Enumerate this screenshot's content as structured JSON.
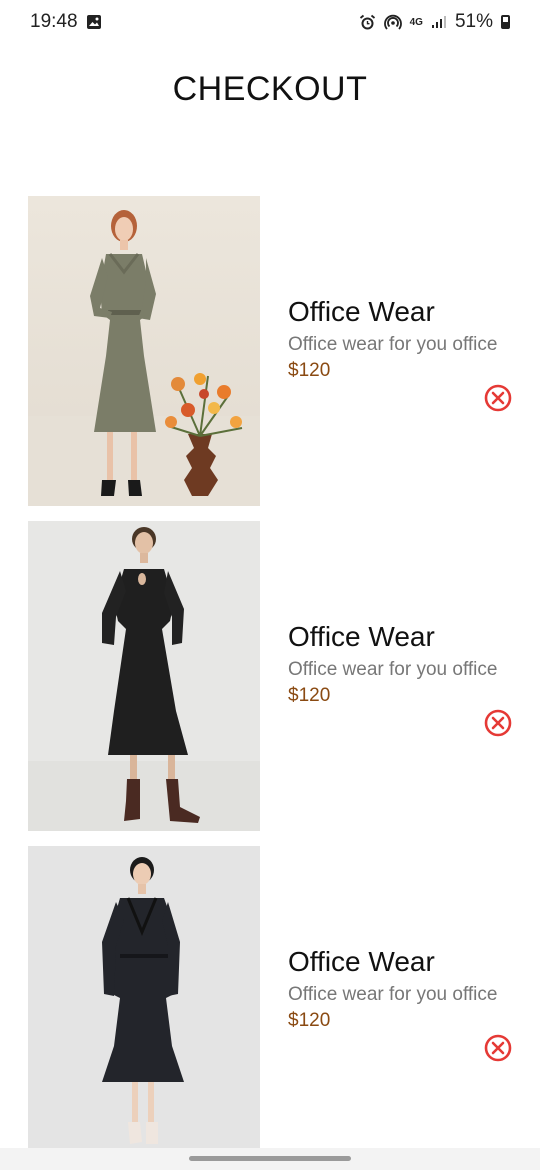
{
  "status_bar": {
    "time": "19:48",
    "network_label": "4G",
    "battery_percent": "51%",
    "icons": [
      "gallery-icon",
      "alarm-icon",
      "hotspot-icon",
      "signal-icon",
      "battery-icon"
    ]
  },
  "page": {
    "title": "CHECKOUT"
  },
  "products": [
    {
      "name": "Office Wear",
      "description": "Office wear for you office",
      "price": "$120",
      "image": "woman in grey belted shirt dress beside flower vase"
    },
    {
      "name": "Office Wear",
      "description": "Office wear for you office",
      "price": "$120",
      "image": "woman in black long-sleeve dress with ankle boots"
    },
    {
      "name": "Office Wear",
      "description": "Office wear for you office",
      "price": "$120",
      "image": "woman in black collared coat dress"
    }
  ],
  "colors": {
    "price": "#8a4a12",
    "remove": "#e53935",
    "description": "#777777"
  }
}
